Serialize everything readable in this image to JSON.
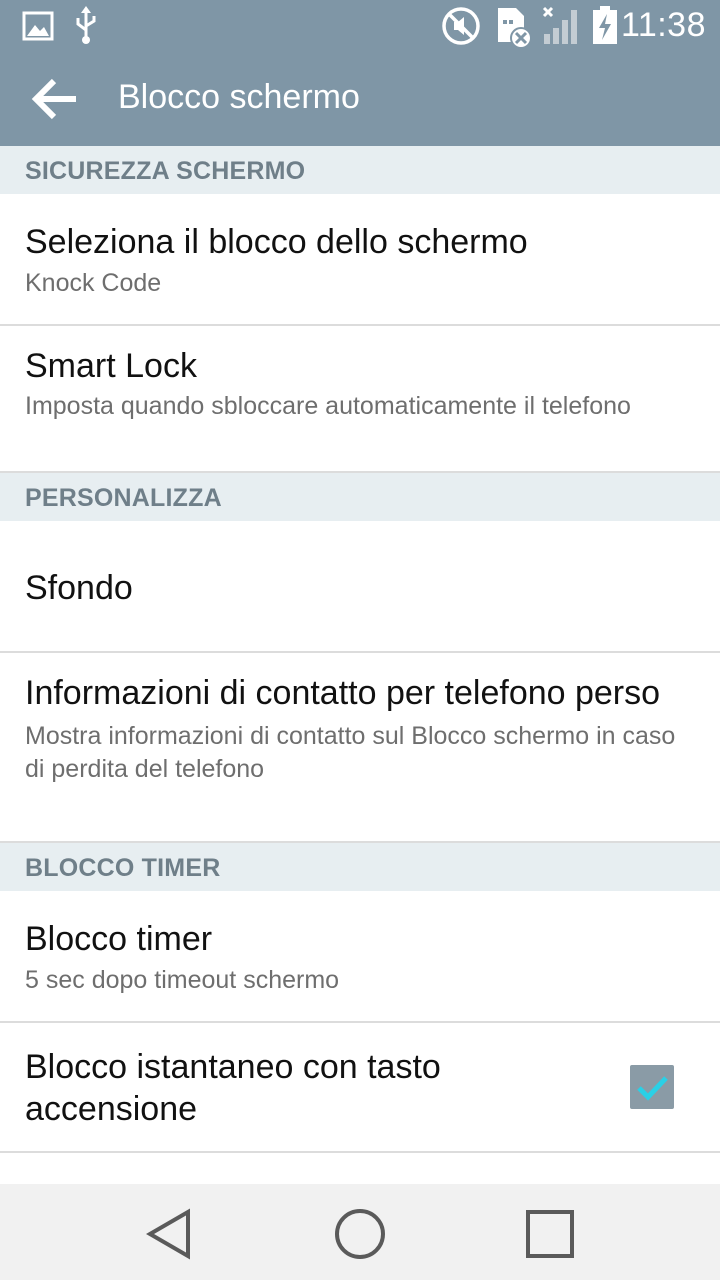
{
  "status_bar": {
    "time": "11:38",
    "icons": [
      "image-icon",
      "usb-icon",
      "mute-icon",
      "sim-error-icon",
      "signal-icon",
      "battery-charging-icon"
    ]
  },
  "app_bar": {
    "title": "Blocco schermo",
    "back_icon": "arrow-left-icon"
  },
  "sections": [
    {
      "header": "SICUREZZA SCHERMO",
      "items": [
        {
          "title": "Seleziona il blocco dello schermo",
          "subtitle": "Knock Code"
        },
        {
          "title": "Smart Lock",
          "subtitle": "Imposta quando sbloccare automaticamente il telefono"
        }
      ]
    },
    {
      "header": "PERSONALIZZA",
      "items": [
        {
          "title": "Sfondo"
        },
        {
          "title": "Informazioni di contatto per telefono perso",
          "subtitle": "Mostra informazioni di contatto sul Blocco schermo in caso di perdita del telefono"
        }
      ]
    },
    {
      "header": "BLOCCO TIMER",
      "items": [
        {
          "title": "Blocco timer",
          "subtitle": "5 sec dopo timeout schermo"
        },
        {
          "title": "Blocco istantaneo con tasto accensione",
          "checkbox_checked": true
        }
      ]
    }
  ],
  "nav_bar": {
    "icons": [
      "back-triangle-icon",
      "home-circle-icon",
      "recents-square-icon"
    ]
  },
  "colors": {
    "app_bar": "#7f96a6",
    "section_header_bg": "#e7eef1",
    "section_header_text": "#6f7f89",
    "checkbox_bg": "#8a9ba6",
    "check_mark": "#2ad0e6"
  }
}
